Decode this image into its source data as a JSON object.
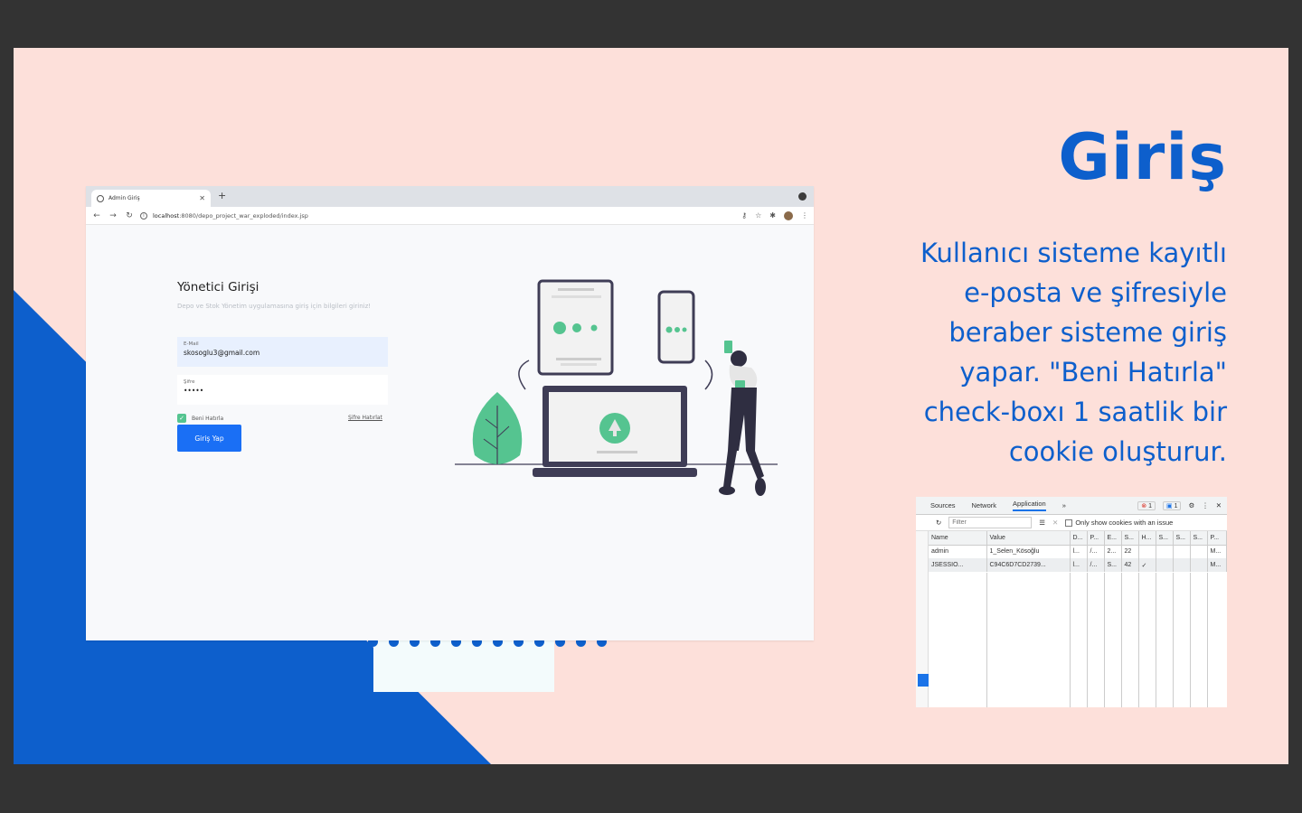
{
  "slide": {
    "title": "Giriş",
    "description": "Kullanıcı sisteme kayıtlı e-posta ve şifresiyle beraber sisteme giriş yapar. \"Beni Hatırla\" check-boxı 1 saatlik bir cookie oluşturur.",
    "accent_color": "#0d5fcc",
    "background_color": "#fde0da"
  },
  "browser": {
    "tab_title": "Admin Giriş",
    "url_host": "localhost",
    "url_rest": ":8080/depo_project_war_exploded/index.jsp"
  },
  "login": {
    "title": "Yönetici Girişi",
    "description": "Depo ve Stok Yönetim uygulamasına giriş için bilgileri giriniz!",
    "email_label": "E-Mail",
    "email_value": "skosoglu3@gmail.com",
    "password_label": "Şifre",
    "password_value": "•••••",
    "remember_label": "Beni Hatırla",
    "forgot_label": "Şifre Hatırlat",
    "submit_label": "Giriş Yap",
    "accent_color": "#1a6ff5",
    "illustration_color": "#55c490"
  },
  "devtools": {
    "tabs": [
      "Sources",
      "Network",
      "Application",
      "»"
    ],
    "active_tab": "Application",
    "error_badge": "1",
    "message_badge": "1",
    "filter_placeholder": "Filter",
    "only_issue_label": "Only show cookies with an issue",
    "columns": [
      "Name",
      "Value",
      "D...",
      "P...",
      "E...",
      "S...",
      "H...",
      "S...",
      "S...",
      "S...",
      "P..."
    ],
    "rows": [
      [
        "admin",
        "1_Selen_Kösoğlu",
        "l...",
        "/...",
        "2...",
        "22",
        "",
        "",
        "",
        "",
        "M..."
      ],
      [
        "JSESSIO...",
        "C94C6D7CD2739...",
        "l...",
        "/...",
        "S...",
        "42",
        "✓",
        "",
        "",
        "",
        "M..."
      ]
    ]
  }
}
